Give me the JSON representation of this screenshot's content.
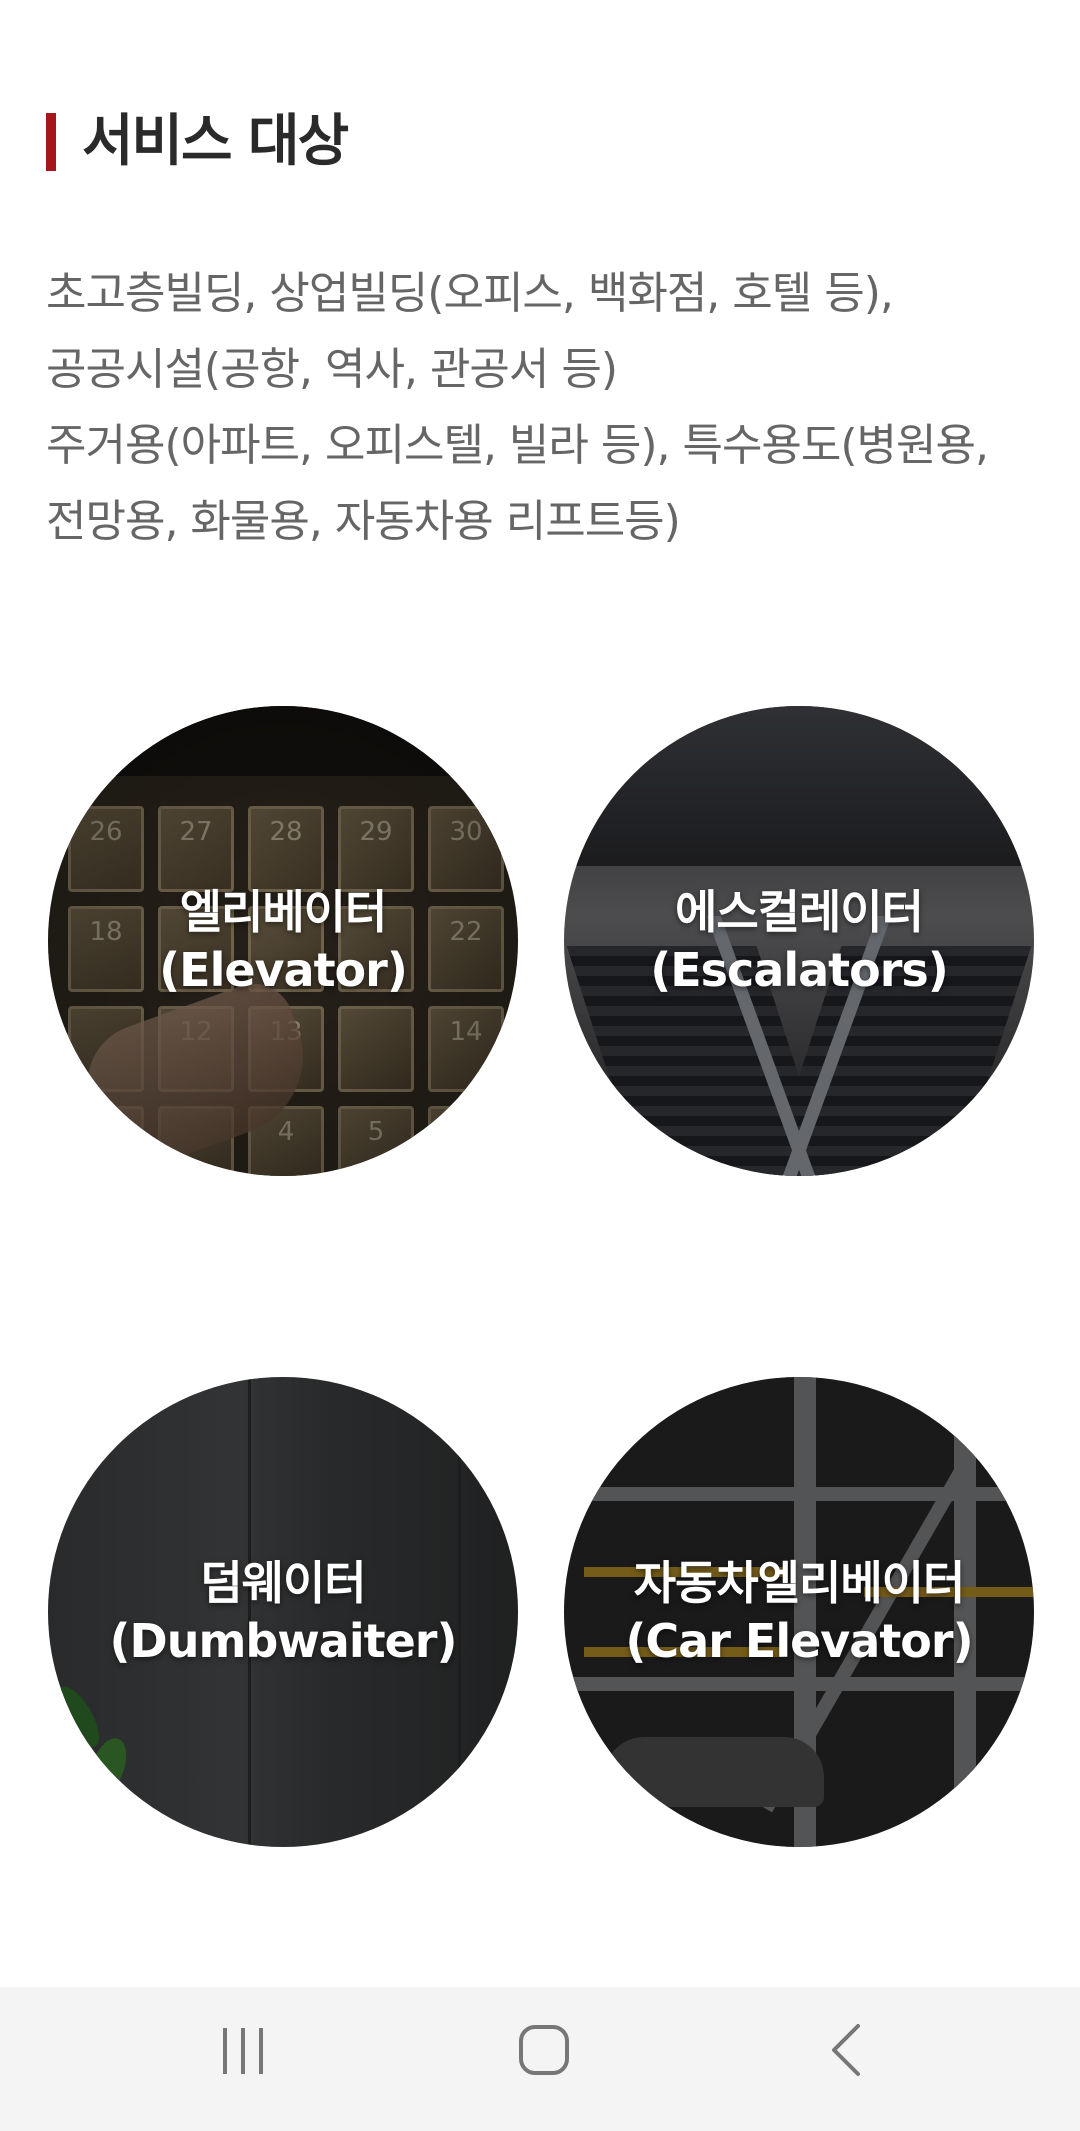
{
  "section": {
    "title": "서비스 대상",
    "accent_color": "#a5161b",
    "description_lines": [
      "초고층빌딩, 상업빌딩(오피스, 백화점, 호텔 등),",
      "공공시설(공항, 역사, 관공서 등)",
      "주거용(아파트, 오피스텔, 빌라 등), 특수용도(병원용,",
      "전망용, 화물용, 자동차용 리프트등)"
    ]
  },
  "services": [
    {
      "name_ko": "엘리베이터",
      "name_en": "(Elevator)"
    },
    {
      "name_ko": "에스컬레이터",
      "name_en": "(Escalators)"
    },
    {
      "name_ko": "덤웨이터",
      "name_en": "(Dumbwaiter)"
    },
    {
      "name_ko": "자동차엘리베이터",
      "name_en": "(Car Elevator)"
    }
  ],
  "elevator_keys": [
    "26",
    "27",
    "28",
    "29",
    "30",
    "18",
    "",
    "",
    "",
    "22",
    "",
    "12",
    "13",
    "",
    "14",
    "",
    "",
    "4",
    "5",
    ""
  ],
  "nav": {
    "recent_icon": "recent-apps-icon",
    "home_icon": "home-icon",
    "back_icon": "back-icon"
  }
}
